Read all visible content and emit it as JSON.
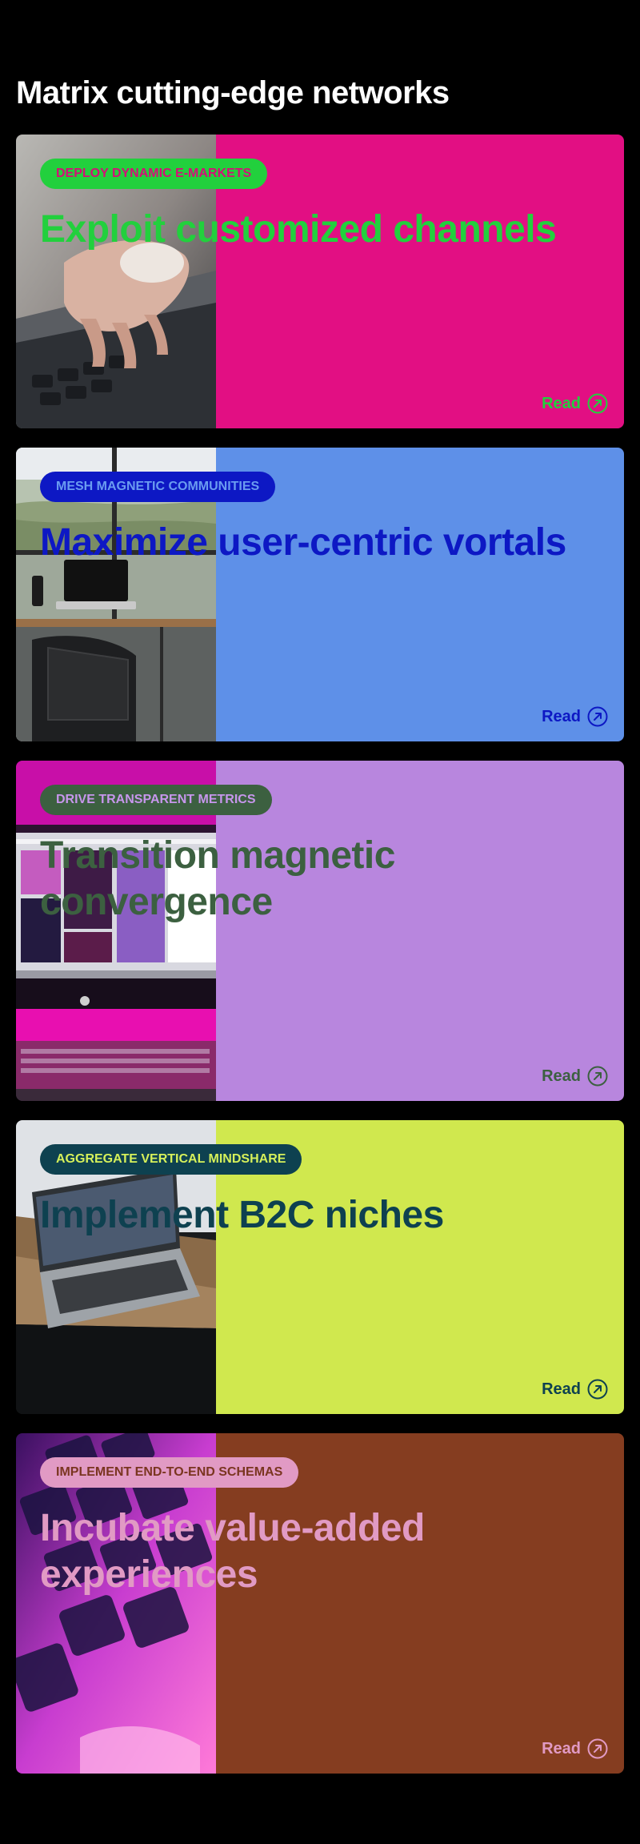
{
  "page": {
    "title": "Matrix cutting-edge networks"
  },
  "cards": [
    {
      "tag": "Deploy dynamic e-markets",
      "title": "Exploit customized channels",
      "read_label": "Read",
      "image": "laptop-typing-photo",
      "colors": {
        "bg": "#e20f83",
        "accent": "#22d03d",
        "tag_text": "#d40f78"
      }
    },
    {
      "tag": "Mesh magnetic communities",
      "title": "Maximize user-centric vortals",
      "read_label": "Read",
      "image": "office-desk-window-photo",
      "colors": {
        "bg": "#5e90e8",
        "accent": "#0d18c4",
        "tag_text": "#6a9cf0"
      }
    },
    {
      "tag": "Drive transparent metrics",
      "title": "Transition magnetic convergence",
      "read_label": "Read",
      "image": "imac-pink-keyboard-photo",
      "colors": {
        "bg": "#b886de",
        "accent": "#3c6040",
        "tag_text": "#c796ec"
      }
    },
    {
      "tag": "Aggregate vertical mindshare",
      "title": "Implement B2C niches",
      "read_label": "Read",
      "image": "macbook-wooden-table-photo",
      "colors": {
        "bg": "#d0e84e",
        "accent": "#0e4150",
        "tag_text": "#d6f05a"
      }
    },
    {
      "tag": "Implement end-to-end schemas",
      "title": "Incubate value-added experiences",
      "read_label": "Read",
      "image": "neon-keyboard-closeup-photo",
      "colors": {
        "bg": "#853d20",
        "accent": "#e19ac4",
        "tag_text": "#7a3520"
      }
    }
  ]
}
